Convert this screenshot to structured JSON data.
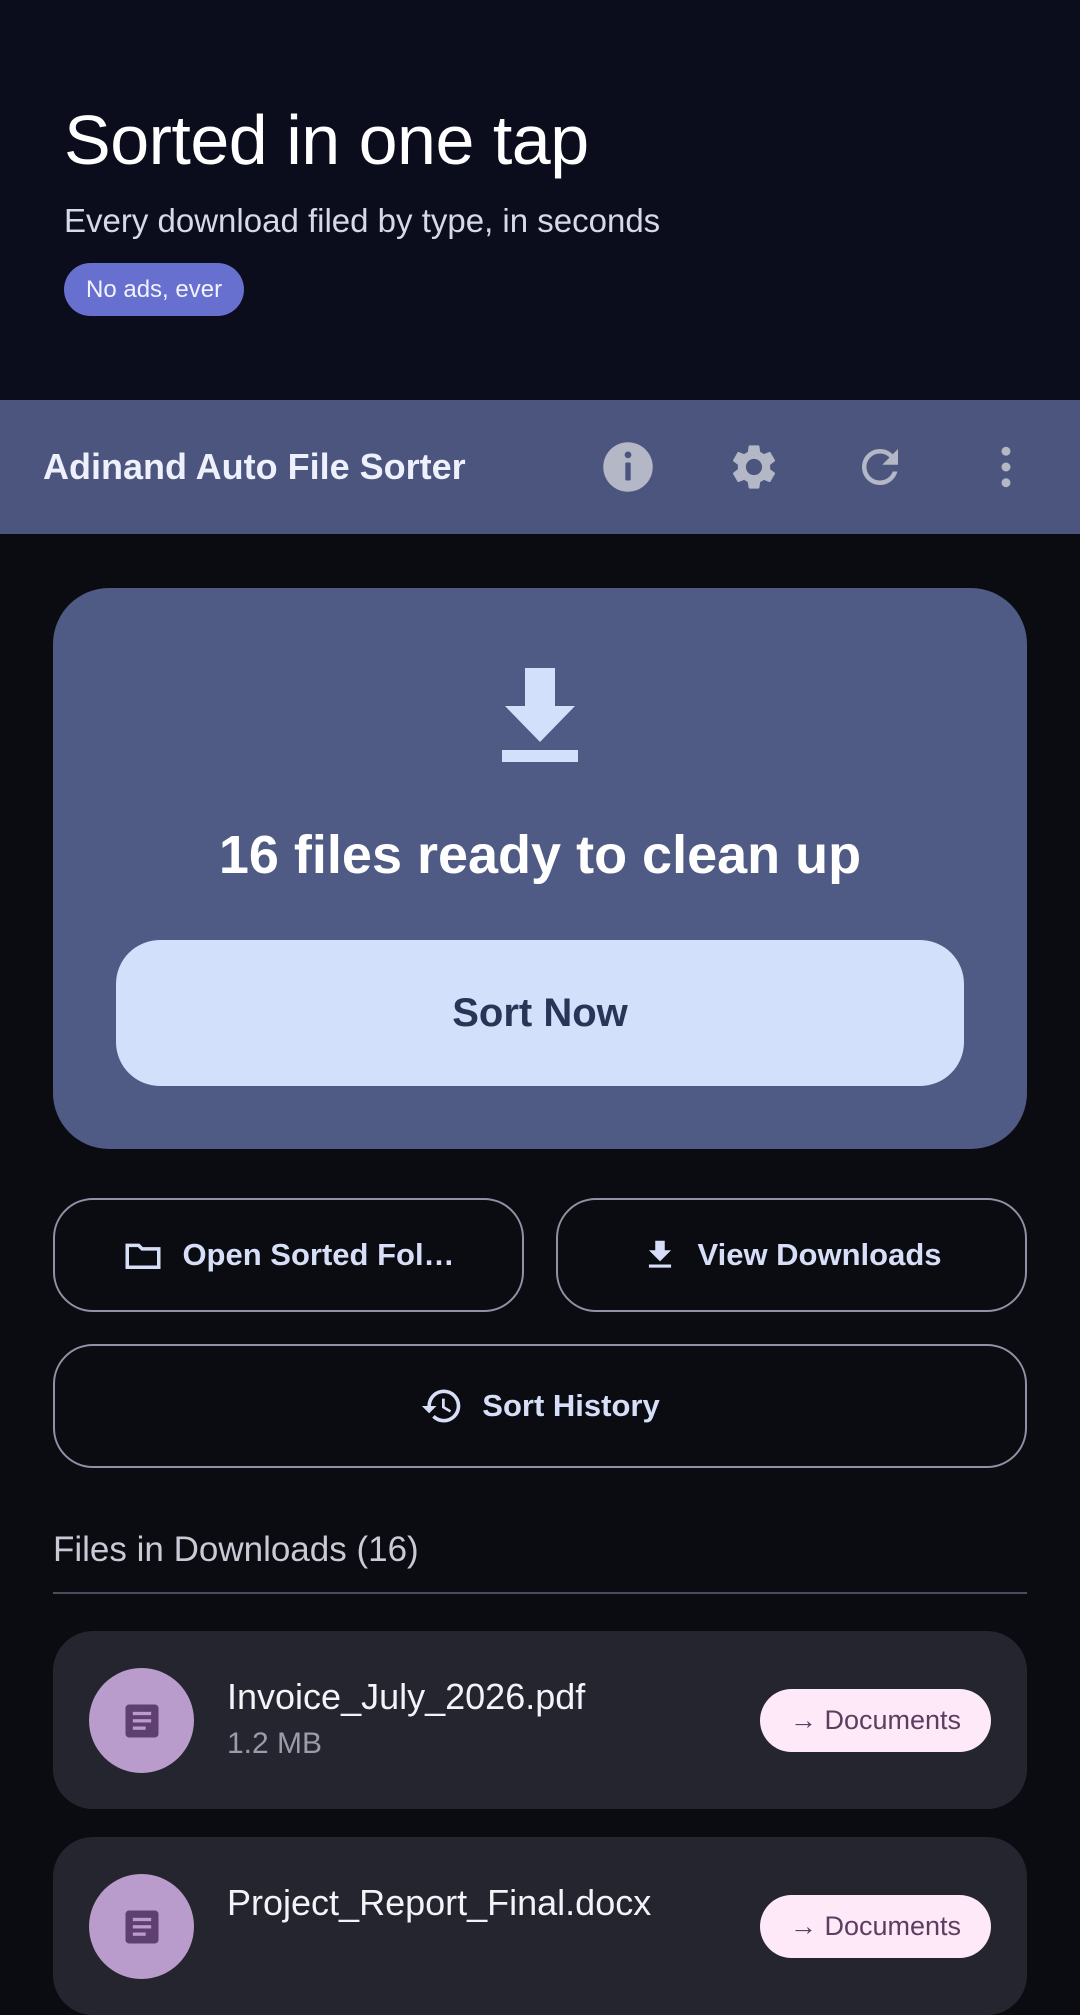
{
  "hero": {
    "title": "Sorted in one tap",
    "subtitle": "Every download filed by type, in seconds",
    "badge": "No ads, ever"
  },
  "appbar": {
    "title": "Adinand Auto File Sorter",
    "icons": [
      "info-icon",
      "gear-icon",
      "refresh-icon",
      "more-vert-icon"
    ]
  },
  "summary": {
    "icon": "download-icon",
    "title": "16 files ready to clean up",
    "sort_label": "Sort Now"
  },
  "actions": {
    "open_sorted_label": "Open Sorted Fol…",
    "view_downloads_label": "View Downloads",
    "history_label": "Sort History"
  },
  "files_section": {
    "title": "Files in Downloads (16)"
  },
  "files": [
    {
      "name": "Invoice_July_2026.pdf",
      "size": "1.2 MB",
      "destination": "→ Documents",
      "icon": "document-icon"
    },
    {
      "name": "Project_Report_Final.docx",
      "size": "",
      "destination": "→ Documents",
      "icon": "document-icon"
    }
  ],
  "colors": {
    "hero_bg": "#0b0d1d",
    "appbar_bg": "#4b557e",
    "card_bg": "#4f5b85",
    "primary_button": "#d2e0fc",
    "badge": "#6870cf",
    "tag_bg": "#fde9f8"
  }
}
